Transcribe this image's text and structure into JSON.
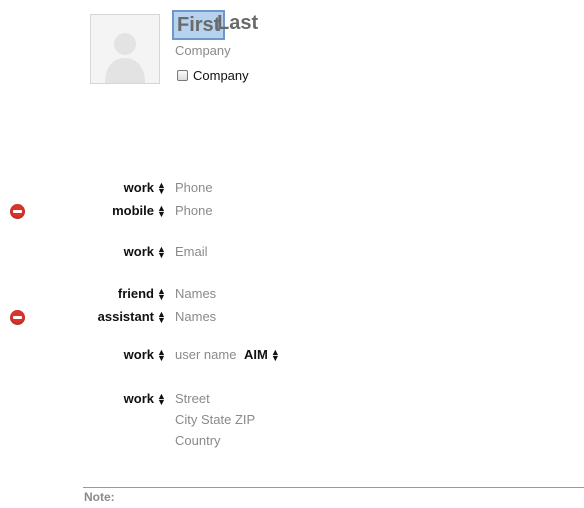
{
  "card": {
    "first_name": "First",
    "last_name": "Last",
    "company_placeholder": "Company",
    "company_checkbox_label": "Company"
  },
  "fields": {
    "phone1": {
      "label": "work",
      "value": "Phone"
    },
    "phone2": {
      "label": "mobile",
      "value": "Phone"
    },
    "email": {
      "label": "work",
      "value": "Email"
    },
    "name1": {
      "label": "friend",
      "value": "Names"
    },
    "name2": {
      "label": "assistant",
      "value": "Names"
    },
    "im": {
      "label": "work",
      "value": "user name",
      "service": "AIM"
    },
    "address": {
      "label": "work",
      "street": "Street",
      "city": "City State ZIP",
      "country": "Country"
    }
  },
  "note": {
    "label": "Note:"
  },
  "icons": {
    "avatar": "person-silhouette-icon",
    "remove": "remove-minus-icon",
    "stepper": "up-down-arrows-icon"
  },
  "colors": {
    "remove": "#d9342b",
    "selection": "#b5d2ef"
  }
}
